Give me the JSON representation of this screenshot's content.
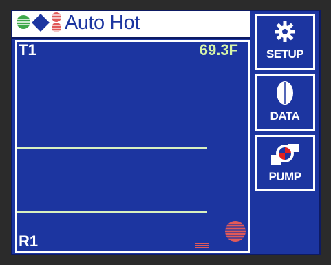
{
  "header": {
    "mode_label": "Auto Hot",
    "status_icons": [
      "green-status-icon",
      "blue-diamond-icon",
      "red-stack-icon"
    ]
  },
  "graph": {
    "sensor_label": "T1",
    "temperature": "69.3F",
    "relay_label": "R1"
  },
  "buttons": {
    "setup": {
      "label": "SETUP",
      "icon": "gear-icon"
    },
    "data": {
      "label": "DATA",
      "icon": "drop-icon"
    },
    "pump": {
      "label": "PUMP",
      "icon": "pump-icon"
    }
  },
  "colors": {
    "background": "#1c35a0",
    "border": "#ffffff",
    "trace": "#d9f0c0",
    "temperature": "#d7f5a8",
    "status_green": "#3fa84b",
    "status_red": "#e05a5a",
    "pump_red": "#e02020"
  }
}
